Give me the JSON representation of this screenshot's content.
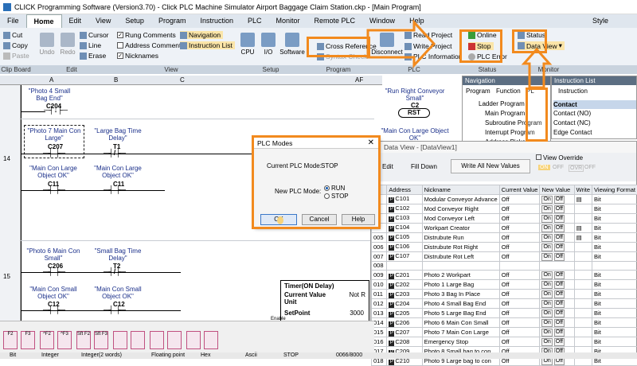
{
  "window": {
    "title": "CLICK Programming Software (Version3.70) - Click PLC Machine Simulator Airport Baggage Claim Station.ckp - [Main Program]"
  },
  "menu": {
    "tabs": [
      "File",
      "Home",
      "Edit",
      "View",
      "Setup",
      "Program",
      "Instruction",
      "PLC",
      "Monitor",
      "Remote PLC",
      "Window",
      "Help"
    ],
    "active": "Home",
    "style": "Style"
  },
  "ribbon": {
    "clipboard": {
      "cut": "Cut",
      "copy": "Copy",
      "paste": "Paste",
      "label": "Clip Board"
    },
    "edit": {
      "undo": "Undo",
      "redo": "Redo",
      "cursor": "Cursor",
      "line": "Line",
      "erase": "Erase",
      "label": "Edit"
    },
    "view": {
      "rung_comments": "Rung Comments",
      "address_comments": "Address Comments",
      "nicknames": "Nicknames",
      "navigation": "Navigation",
      "instruction_list": "Instruction List",
      "label": "View"
    },
    "setup": {
      "cpu": "CPU",
      "io": "I/O",
      "software": "Software",
      "label": "Setup"
    },
    "program": {
      "cross_reference": "Cross Reference",
      "symbol_check": "Syntax Check",
      "label": "Program"
    },
    "plc": {
      "connect": "Disconnect",
      "read_project": "Read Project",
      "write_project": "Write Project",
      "plc_information": "PLC Information",
      "label": "PLC"
    },
    "status": {
      "online": "Online",
      "stop": "Stop",
      "plc_error": "PLC Error",
      "label": "Status"
    },
    "monitor": {
      "status": "Status",
      "data_view": "Data View",
      "label": "Monitor"
    }
  },
  "ladder": {
    "columns": [
      "A",
      "B",
      "C",
      "AF"
    ],
    "rungs": [
      {
        "number": "",
        "contacts": [
          {
            "label": "\"Photo 4 Small Bag End\"",
            "addr": "C204"
          }
        ],
        "coil": {
          "label": "\"Run Right Conveyor Small\"",
          "addr": "C2",
          "type": "RST"
        }
      },
      {
        "number": "14",
        "contacts": [
          {
            "label": "\"Photo 7 Main Con Large\"",
            "addr": "C207"
          },
          {
            "label": "\"Large Bag Time Delay\"",
            "addr": "T1"
          },
          {
            "label": "\"Main Con Large Object OK\"",
            "addr": "C11"
          },
          {
            "label": "\"Main Con Large Object OK\"",
            "addr": "C11"
          }
        ],
        "coil": {
          "label": "\"Main Con Large Object OK\"",
          "addr": "C11"
        }
      },
      {
        "number": "15",
        "contacts": [
          {
            "label": "\"Photo 6 Main Con Small\"",
            "addr": "C206"
          },
          {
            "label": "\"Small Bag Time Delay\"",
            "addr": "T2"
          },
          {
            "label": "\"Main Con Small Object OK\"",
            "addr": "C12"
          },
          {
            "label": "\"Main Con Small Object OK\"",
            "addr": "C12"
          }
        ]
      }
    ],
    "timer": {
      "title": "Timer(ON Delay)",
      "current_value": "Current Value",
      "not_ready": "Not R",
      "unit": "Unit",
      "setpoint": "SetPoint",
      "setpoint_val": "3000",
      "enable": "Enable"
    }
  },
  "plc_modes_dialog": {
    "title": "PLC Modes",
    "close": "✕",
    "current_label": "Current PLC Mode:",
    "current_value": "STOP",
    "new_label": "New PLC Mode:",
    "options": [
      "RUN",
      "STOP"
    ],
    "selected": "RUN",
    "buttons": {
      "ok": "OK",
      "cancel": "Cancel",
      "help": "Help"
    }
  },
  "navigation": {
    "title": "Navigation",
    "tabs": [
      "Program",
      "Function",
      "PL"
    ],
    "tree": [
      "Ladder Program",
      "Main Program",
      "Subroutine Program",
      "Interrupt Program",
      "Address Picker"
    ]
  },
  "instruction_list": {
    "title": "Instruction List",
    "tab": "Instruction",
    "items": [
      "Contact",
      "Contact (NO)",
      "Contact (NC)",
      "Edge Contact"
    ]
  },
  "data_view": {
    "title": "Data View - [DataView1]",
    "toolbar": {
      "edit": "Edit",
      "fill_down": "Fill Down",
      "write_all": "Write All New Values",
      "view_override": "View Override",
      "on": "ON",
      "off1": "OFF",
      "ovr": "OVR",
      "off2": "OFF"
    },
    "headers": [
      "Address",
      "Nickname",
      "Current Value",
      "New Value",
      "Write",
      "Viewing Format"
    ],
    "rows": [
      {
        "num": "",
        "addr": "C101",
        "nick": "Modular Conveyor Advance",
        "cur": "Off",
        "fmt": "Bit",
        "write": true
      },
      {
        "num": "",
        "addr": "C102",
        "nick": "Mod Conveyor Right",
        "cur": "Off",
        "fmt": "Bit",
        "write": false
      },
      {
        "num": "",
        "addr": "C103",
        "nick": "Mod Conveyor Left",
        "cur": "Off",
        "fmt": "Bit",
        "write": false
      },
      {
        "num": "",
        "addr": "C104",
        "nick": "Workpart Creator",
        "cur": "Off",
        "fmt": "Bit",
        "write": true
      },
      {
        "num": "005",
        "addr": "C105",
        "nick": "Distrubute Run",
        "cur": "Off",
        "fmt": "Bit",
        "write": true
      },
      {
        "num": "006",
        "addr": "C106",
        "nick": "Distrubute Rot Right",
        "cur": "Off",
        "fmt": "Bit",
        "write": false
      },
      {
        "num": "007",
        "addr": "C107",
        "nick": "Distrubute Rot Left",
        "cur": "Off",
        "fmt": "Bit",
        "write": false
      },
      {
        "num": "008",
        "addr": "",
        "nick": "",
        "cur": "",
        "fmt": "",
        "write": false
      },
      {
        "num": "009",
        "addr": "C201",
        "nick": "Photo 2 Workpart",
        "cur": "Off",
        "fmt": "Bit",
        "write": false
      },
      {
        "num": "010",
        "addr": "C202",
        "nick": "Photo 1 Large Bag",
        "cur": "Off",
        "fmt": "Bit",
        "write": false
      },
      {
        "num": "011",
        "addr": "C203",
        "nick": "Photo 3 Bag In Place",
        "cur": "Off",
        "fmt": "Bit",
        "write": false
      },
      {
        "num": "012",
        "addr": "C204",
        "nick": "Photo 4 Small Bag End",
        "cur": "Off",
        "fmt": "Bit",
        "write": false
      },
      {
        "num": "013",
        "addr": "C205",
        "nick": "Photo 5 Large Bag End",
        "cur": "Off",
        "fmt": "Bit",
        "write": false
      },
      {
        "num": "014",
        "addr": "C206",
        "nick": "Photo 6 Main Con Small",
        "cur": "Off",
        "fmt": "Bit",
        "write": false
      },
      {
        "num": "015",
        "addr": "C207",
        "nick": "Photo 7 Main Con Large",
        "cur": "Off",
        "fmt": "Bit",
        "write": false
      },
      {
        "num": "016",
        "addr": "C208",
        "nick": "Emergency Stop",
        "cur": "Off",
        "fmt": "Bit",
        "write": false
      },
      {
        "num": "017",
        "addr": "C209",
        "nick": "Photo 8 Small bag to con",
        "cur": "Off",
        "fmt": "Bit",
        "write": false
      },
      {
        "num": "018",
        "addr": "C210",
        "nick": "Photo 9 Large bag to con",
        "cur": "Off",
        "fmt": "Bit",
        "write": false
      }
    ],
    "new_on": "On",
    "new_off": "Off"
  },
  "fkeys": [
    "F2",
    "F3",
    "^F2",
    "^F3",
    "Sft F2",
    "Sft F3",
    "",
    "",
    "",
    "",
    "",
    "",
    ""
  ],
  "status_bar": {
    "bit": "Bit",
    "integer": "Integer",
    "integer2": "Integer(2 words)",
    "floating": "Floating point",
    "hex": "Hex",
    "ascii": "Ascii",
    "stop": "STOP",
    "count": "0066/8000"
  },
  "colors": {
    "orange": "#f28a1e",
    "ribbon": "#eef2f7",
    "nav_header": "#5c6e82"
  }
}
